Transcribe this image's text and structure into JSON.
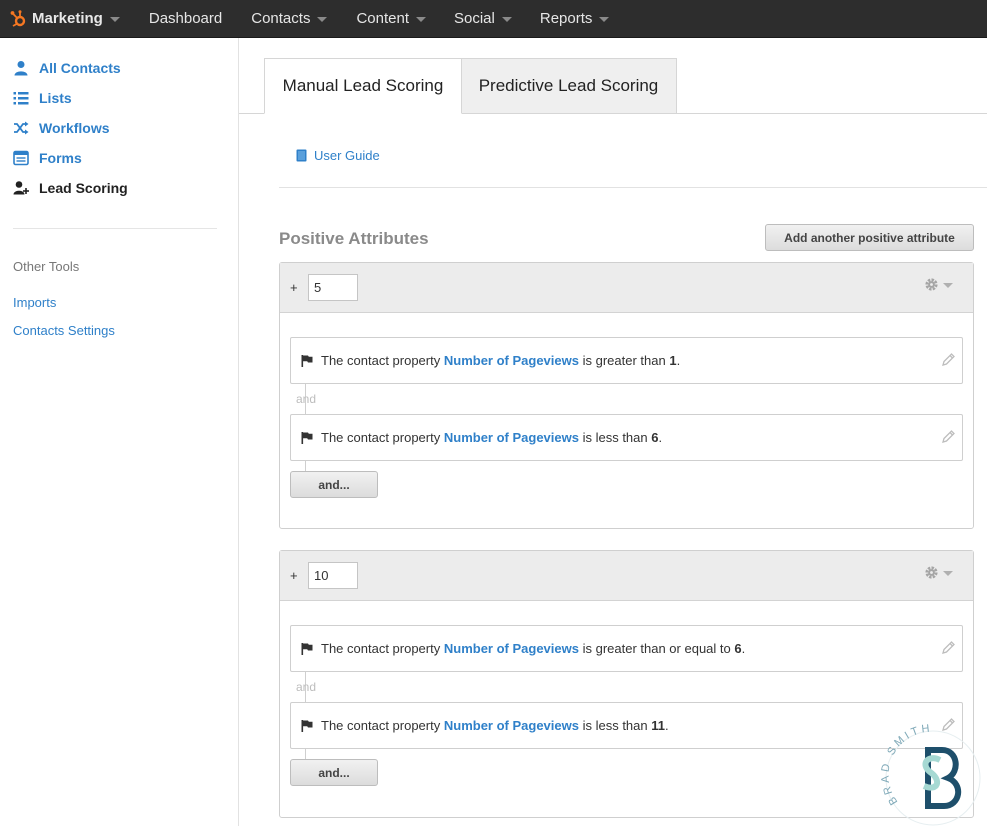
{
  "nav": {
    "brand": "Marketing",
    "items": [
      "Dashboard",
      "Contacts",
      "Content",
      "Social",
      "Reports"
    ]
  },
  "sidebar": {
    "items": [
      {
        "label": "All Contacts",
        "icon": "user-icon"
      },
      {
        "label": "Lists",
        "icon": "list-icon"
      },
      {
        "label": "Workflows",
        "icon": "shuffle-icon"
      },
      {
        "label": "Forms",
        "icon": "form-icon"
      },
      {
        "label": "Lead Scoring",
        "icon": "user-plus-icon",
        "active": true
      }
    ],
    "other_heading": "Other Tools",
    "other_links": [
      "Imports",
      "Contacts Settings"
    ]
  },
  "tabs": {
    "manual": "Manual Lead Scoring",
    "predictive": "Predictive Lead Scoring"
  },
  "user_guide": "User Guide",
  "section": {
    "title": "Positive Attributes",
    "add_button": "Add another positive attribute"
  },
  "groups": [
    {
      "plus": "+",
      "score": "5",
      "conditions": [
        {
          "prefix": "The contact property",
          "property": "Number of Pageviews",
          "operator": "is greater than",
          "value": "1",
          "suffix": "."
        },
        {
          "prefix": "The contact property",
          "property": "Number of Pageviews",
          "operator": "is less than",
          "value": "6",
          "suffix": "."
        }
      ],
      "and_label": "and",
      "and_button": "and..."
    },
    {
      "plus": "+",
      "score": "10",
      "conditions": [
        {
          "prefix": "The contact property",
          "property": "Number of Pageviews",
          "operator": "is greater than or equal to",
          "value": "6",
          "suffix": "."
        },
        {
          "prefix": "The contact property",
          "property": "Number of Pageviews",
          "operator": "is less than",
          "value": "11",
          "suffix": "."
        }
      ],
      "and_label": "and",
      "and_button": "and..."
    }
  ],
  "watermark": {
    "text": "BRAD SMITH"
  },
  "colors": {
    "nav_bg": "#2d2d2d",
    "brand_orange": "#f57722",
    "link_blue": "#2f80c9",
    "watermark_teal": "#1e4f6b",
    "watermark_mint": "#a6d9d3"
  }
}
